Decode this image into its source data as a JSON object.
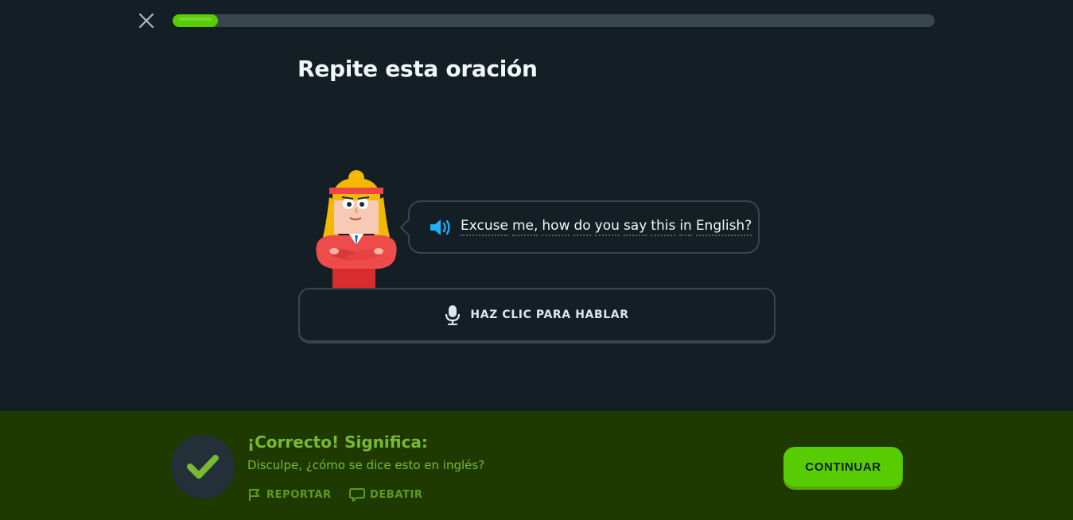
{
  "header": {
    "close_icon": "close-icon",
    "progress_fraction": 0.06
  },
  "prompt": {
    "title": "Repite esta oración"
  },
  "bubble": {
    "speaker_icon": "speaker-icon",
    "words": [
      "Excuse",
      "me,",
      "how",
      "do",
      "you",
      "say",
      "this",
      "in",
      "English?"
    ]
  },
  "mic_button": {
    "icon": "microphone-icon",
    "label": "HAZ CLIC PARA HABLAR"
  },
  "feedback": {
    "title": "¡Correcto! Significa:",
    "meaning": "Disculpe, ¿cómo se dice esto en inglés?",
    "report_label": "REPORTAR",
    "discuss_label": "DEBATIR",
    "continue_label": "CONTINUAR"
  },
  "colors": {
    "background": "#131f24",
    "accent_green": "#58cc02",
    "footer_bg": "#1f3a00",
    "feedback_text": "#79b933",
    "border": "#37464f",
    "speaker_blue": "#1cb0f6"
  }
}
